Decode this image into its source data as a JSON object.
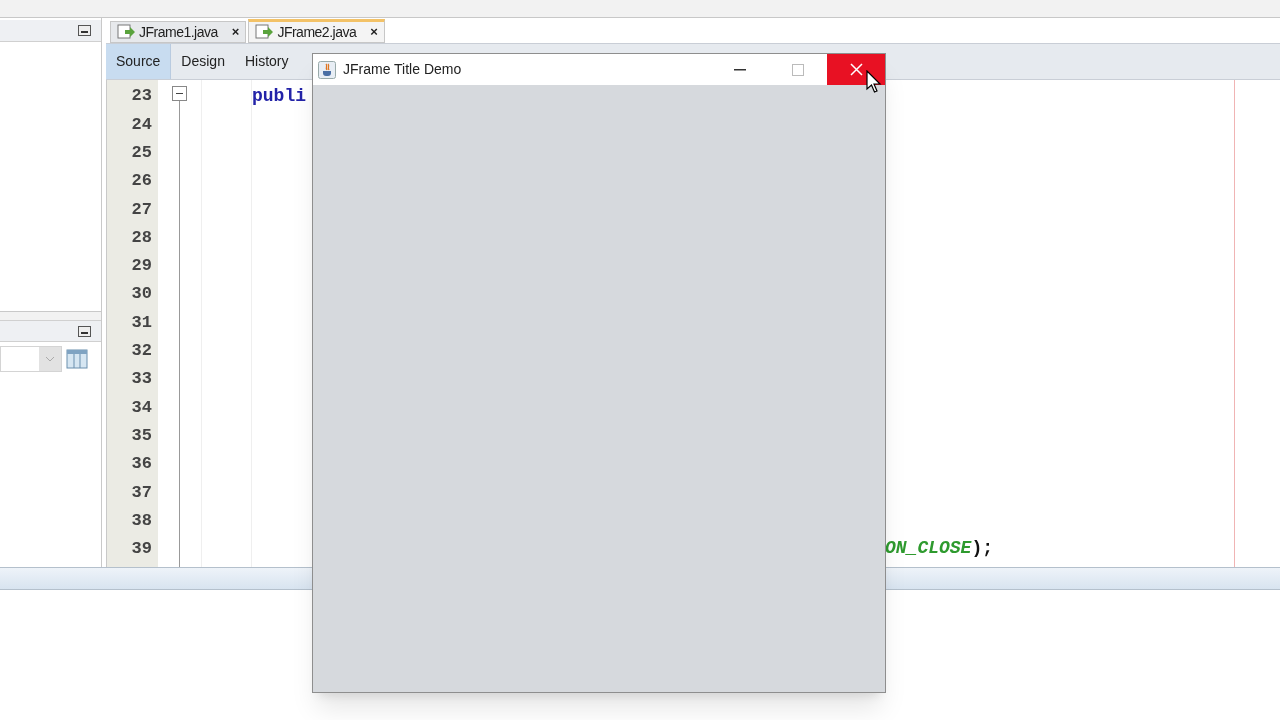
{
  "editor_tabs": [
    {
      "label": "JFrame1.java",
      "selected": false,
      "close": "×"
    },
    {
      "label": "JFrame2.java",
      "selected": true,
      "close": "×"
    }
  ],
  "view_buttons": [
    {
      "label": "Source",
      "selected": true
    },
    {
      "label": "Design",
      "selected": false
    },
    {
      "label": "History",
      "selected": false
    }
  ],
  "code_lines": [
    {
      "number": "23",
      "fold": true,
      "left": [
        {
          "text": "publi",
          "kind": "keyword"
        }
      ]
    },
    {
      "number": "24",
      "fold": false
    },
    {
      "number": "25",
      "fold": false
    },
    {
      "number": "26",
      "fold": false
    },
    {
      "number": "27",
      "fold": false
    },
    {
      "number": "28",
      "fold": false
    },
    {
      "number": "29",
      "fold": false
    },
    {
      "number": "30",
      "fold": false
    },
    {
      "number": "31",
      "fold": false
    },
    {
      "number": "32",
      "fold": false
    },
    {
      "number": "33",
      "fold": false
    },
    {
      "number": "34",
      "fold": false
    },
    {
      "number": "35",
      "fold": false
    },
    {
      "number": "36",
      "fold": false
    },
    {
      "number": "37",
      "fold": false
    },
    {
      "number": "38",
      "fold": false
    },
    {
      "number": "39",
      "fold": false,
      "right": [
        {
          "text": "ON_CLOSE",
          "kind": "constant"
        },
        {
          "text": ");",
          "kind": "plain"
        }
      ]
    }
  ],
  "frame_window": {
    "title": "JFrame Title Demo",
    "close_hovered": true
  }
}
